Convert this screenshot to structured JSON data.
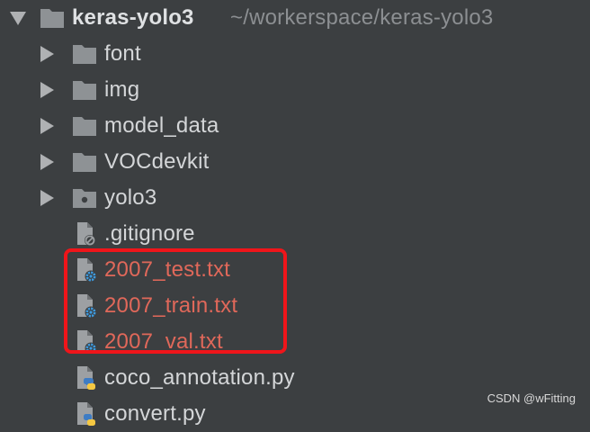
{
  "tree": {
    "root": {
      "name": "keras-yolo3",
      "path": "~/workerspace/keras-yolo3"
    },
    "folders": [
      {
        "name": "font"
      },
      {
        "name": "img"
      },
      {
        "name": "model_data"
      },
      {
        "name": "VOCdevkit"
      },
      {
        "name": "yolo3"
      }
    ],
    "files": [
      {
        "name": ".gitignore",
        "icon": "gitignore-file-icon"
      },
      {
        "name": "2007_test.txt",
        "icon": "config-text-file-icon"
      },
      {
        "name": "2007_train.txt",
        "icon": "config-text-file-icon"
      },
      {
        "name": "2007_val.txt",
        "icon": "config-text-file-icon"
      },
      {
        "name": "coco_annotation.py",
        "icon": "python-file-icon"
      },
      {
        "name": "convert.py",
        "icon": "python-file-icon"
      }
    ]
  },
  "colors": {
    "highlight": "#f0151a",
    "highlighted_text": "#e0685a",
    "background": "#3c3f41"
  },
  "watermark": "CSDN @wFitting"
}
